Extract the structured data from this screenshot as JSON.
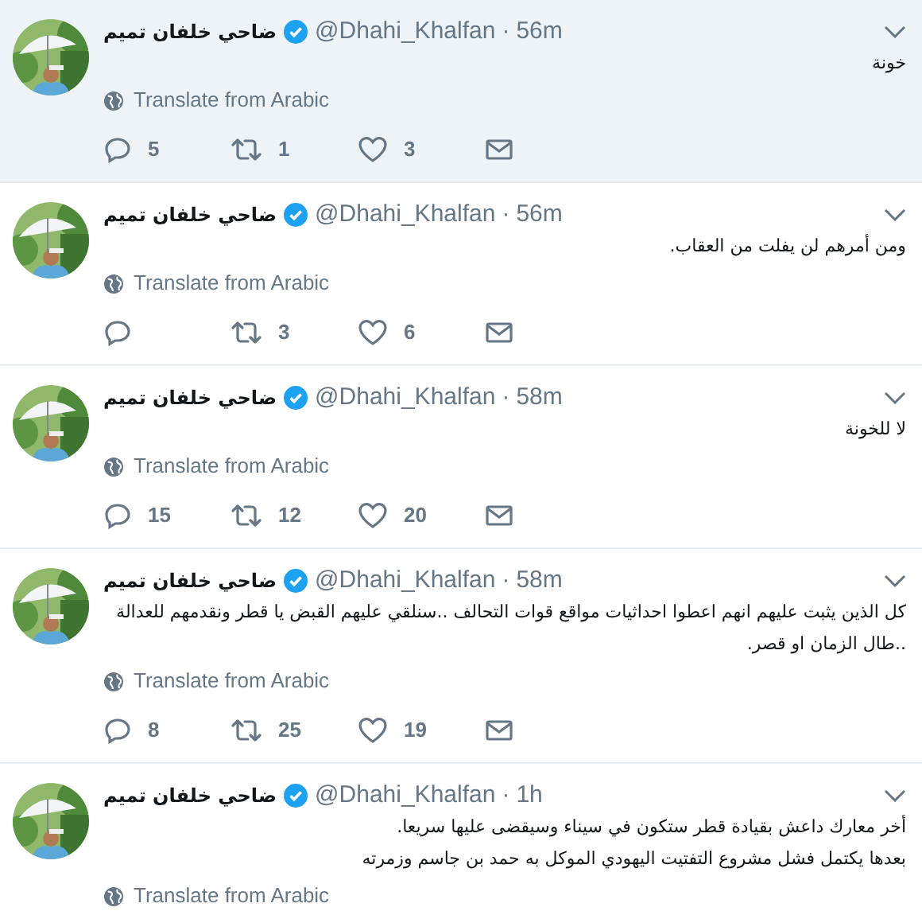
{
  "tweets": [
    {
      "highlighted": true,
      "name": "ضاحي خلفان تميم",
      "verified": true,
      "handle": "@Dhahi_Khalfan",
      "separator": "·",
      "time": "56m",
      "text": "خونة",
      "translate": "Translate from Arabic",
      "actions": {
        "replies": "5",
        "retweets": "1",
        "likes": "3"
      }
    },
    {
      "highlighted": false,
      "name": "ضاحي خلفان تميم",
      "verified": true,
      "handle": "@Dhahi_Khalfan",
      "separator": "·",
      "time": "56m",
      "text": "ومن أمرهم لن يفلت من العقاب.",
      "translate": "Translate from Arabic",
      "actions": {
        "retweets": "3",
        "likes": "6"
      }
    },
    {
      "highlighted": false,
      "name": "ضاحي خلفان تميم",
      "verified": true,
      "handle": "@Dhahi_Khalfan",
      "separator": "·",
      "time": "58m",
      "text": "لا للخونة",
      "translate": "Translate from Arabic",
      "actions": {
        "replies": "15",
        "retweets": "12",
        "likes": "20"
      }
    },
    {
      "highlighted": false,
      "name": "ضاحي خلفان تميم",
      "verified": true,
      "handle": "@Dhahi_Khalfan",
      "separator": "·",
      "time": "58m",
      "text": "كل الذين يثبت عليهم انهم اعطوا احداثيات مواقع قوات التحالف ..سنلقي عليهم القبض يا قطر ونقدمهم للعدالة\n..طال الزمان او قصر.",
      "translate": "Translate from Arabic",
      "actions": {
        "replies": "8",
        "retweets": "25",
        "likes": "19"
      }
    },
    {
      "highlighted": false,
      "name": "ضاحي خلفان تميم",
      "verified": true,
      "handle": "@Dhahi_Khalfan",
      "separator": "·",
      "time": "1h",
      "text": "أخر معارك داعش بقيادة قطر ستكون في سيناء وسيقضى عليها سريعا.\nبعدها يكتمل فشل مشروع التفتيت اليهودي الموكل به حمد بن جاسم وزمرته",
      "translate": "Translate from Arabic"
    }
  ]
}
